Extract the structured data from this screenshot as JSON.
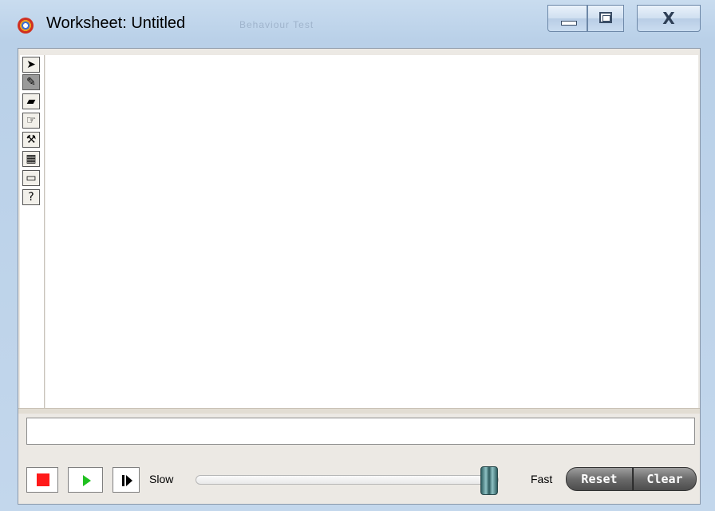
{
  "window": {
    "title": "Worksheet: Untitled",
    "background_title": "Behaviour Test"
  },
  "titlebar": {
    "minimize_icon": "minimize-icon",
    "maximize_icon": "maximize-icon",
    "close_icon": "close-icon",
    "close_glyph": "X"
  },
  "toolbox": {
    "tools": [
      {
        "name": "arrow",
        "glyph": "➤",
        "selected": false
      },
      {
        "name": "pencil",
        "glyph": "✎",
        "selected": true
      },
      {
        "name": "eraser",
        "glyph": "▰",
        "selected": false
      },
      {
        "name": "hand",
        "glyph": "☞",
        "selected": false
      },
      {
        "name": "hammer",
        "glyph": "⚒",
        "selected": false
      },
      {
        "name": "fill",
        "glyph": "▦",
        "selected": false
      },
      {
        "name": "rectangle",
        "glyph": "▭",
        "selected": false
      },
      {
        "name": "help",
        "glyph": "?",
        "selected": false
      }
    ]
  },
  "command": {
    "value": ""
  },
  "controls": {
    "slow_label": "Slow",
    "fast_label": "Fast",
    "speed": 1.0,
    "reset_label": "Reset",
    "clear_label": "Clear"
  }
}
